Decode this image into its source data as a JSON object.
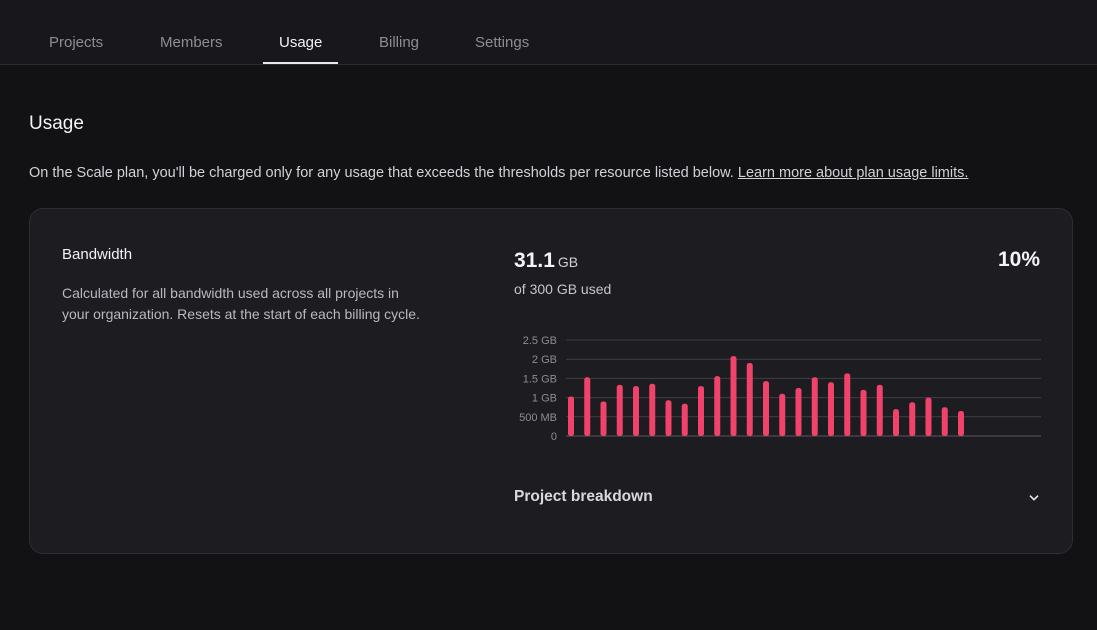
{
  "tabs": [
    {
      "label": "Projects",
      "active": false
    },
    {
      "label": "Members",
      "active": false
    },
    {
      "label": "Usage",
      "active": true
    },
    {
      "label": "Billing",
      "active": false
    },
    {
      "label": "Settings",
      "active": false
    }
  ],
  "page": {
    "title": "Usage",
    "intro": "On the Scale plan, you'll be charged only for any usage that exceeds the thresholds per resource listed below.",
    "intro_link": "Learn more about plan usage limits."
  },
  "bandwidth": {
    "title": "Bandwidth",
    "description": "Calculated for all bandwidth used across all projects in your organization. Resets at the start of each billing cycle.",
    "used_value": "31.1",
    "used_unit": "GB",
    "limit_text": "of 300 GB used",
    "percent": "10%",
    "breakdown_label": "Project breakdown",
    "bar_color": "#f0426a"
  },
  "chart_data": {
    "type": "bar",
    "ytick_labels": [
      "0",
      "500 MB",
      "1 GB",
      "1.5 GB",
      "2 GB",
      "2.5 GB"
    ],
    "ylim": [
      0,
      2.5
    ],
    "yunit": "GB",
    "grid": true,
    "values": [
      1.03,
      1.53,
      0.9,
      1.33,
      1.3,
      1.36,
      0.93,
      0.84,
      1.3,
      1.56,
      2.08,
      1.9,
      1.43,
      1.1,
      1.25,
      1.53,
      1.4,
      1.63,
      1.2,
      1.33,
      0.7,
      0.88,
      1.0,
      0.75,
      0.65
    ]
  }
}
